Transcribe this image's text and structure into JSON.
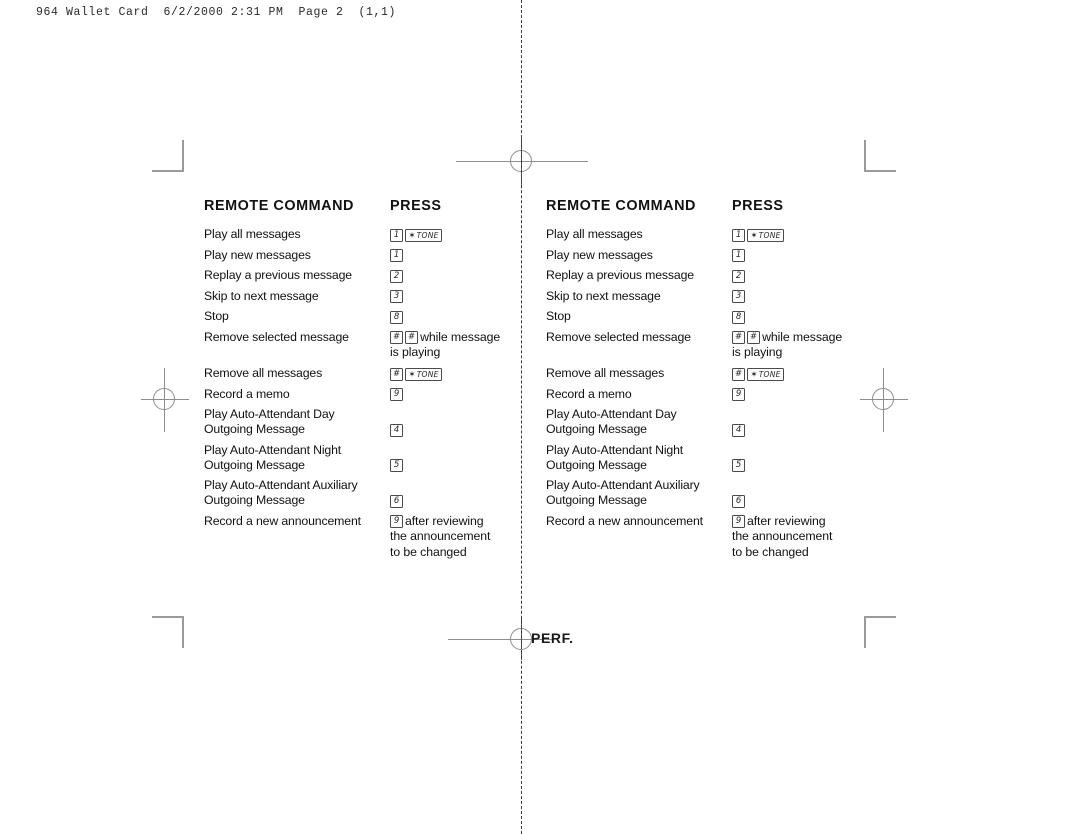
{
  "print_header": "964 Wallet Card  6/2/2000 2:31 PM  Page 2  (1,1)",
  "perf_label": "PERF.",
  "columns": {
    "command_header": "REMOTE COMMAND",
    "press_header": "PRESS"
  },
  "rows": [
    {
      "command_lines": [
        "Play all messages"
      ],
      "keys": [
        "1",
        "*TONE"
      ],
      "note_lines": []
    },
    {
      "command_lines": [
        "Play new messages"
      ],
      "keys": [
        "1"
      ],
      "note_lines": []
    },
    {
      "command_lines": [
        "Replay a previous message"
      ],
      "keys": [
        "2"
      ],
      "note_lines": []
    },
    {
      "command_lines": [
        "Skip to next message"
      ],
      "keys": [
        "3"
      ],
      "note_lines": []
    },
    {
      "command_lines": [
        "Stop"
      ],
      "keys": [
        "8"
      ],
      "note_lines": []
    },
    {
      "command_lines": [
        "Remove selected message"
      ],
      "keys": [
        "#",
        "#"
      ],
      "note_lines": [
        "while message",
        "is playing"
      ]
    },
    {
      "command_lines": [
        "Remove all messages"
      ],
      "keys": [
        "#",
        "*TONE"
      ],
      "note_lines": []
    },
    {
      "command_lines": [
        "Record a memo"
      ],
      "keys": [
        "9"
      ],
      "note_lines": []
    },
    {
      "command_lines": [
        "Play Auto-Attendant Day",
        "Outgoing Message"
      ],
      "keys": [
        "4"
      ],
      "note_lines": [],
      "key_on_second_line": true
    },
    {
      "command_lines": [
        "Play Auto-Attendant Night",
        "Outgoing Message"
      ],
      "keys": [
        "5"
      ],
      "note_lines": [],
      "key_on_second_line": true
    },
    {
      "command_lines": [
        "Play Auto-Attendant Auxiliary",
        "Outgoing Message"
      ],
      "keys": [
        "6"
      ],
      "note_lines": [],
      "key_on_second_line": true
    },
    {
      "command_lines": [
        "Record a new announcement"
      ],
      "keys": [
        "9"
      ],
      "note_lines": [
        "after reviewing",
        "the announcement",
        "to be changed"
      ]
    }
  ],
  "marks": {
    "crop_top_left": "crop-mark-icon",
    "crop_top_right": "crop-mark-icon",
    "crop_bottom_left": "crop-mark-icon",
    "crop_bottom_right": "crop-mark-icon",
    "registration_top": "registration-target-icon",
    "registration_bottom": "registration-target-icon",
    "registration_left": "registration-target-icon",
    "registration_right": "registration-target-icon",
    "fold": "perforation-dashed-line"
  },
  "colors": {
    "ink": "#111111",
    "mark_gray": "#8d8d8d",
    "paper": "#ffffff"
  }
}
